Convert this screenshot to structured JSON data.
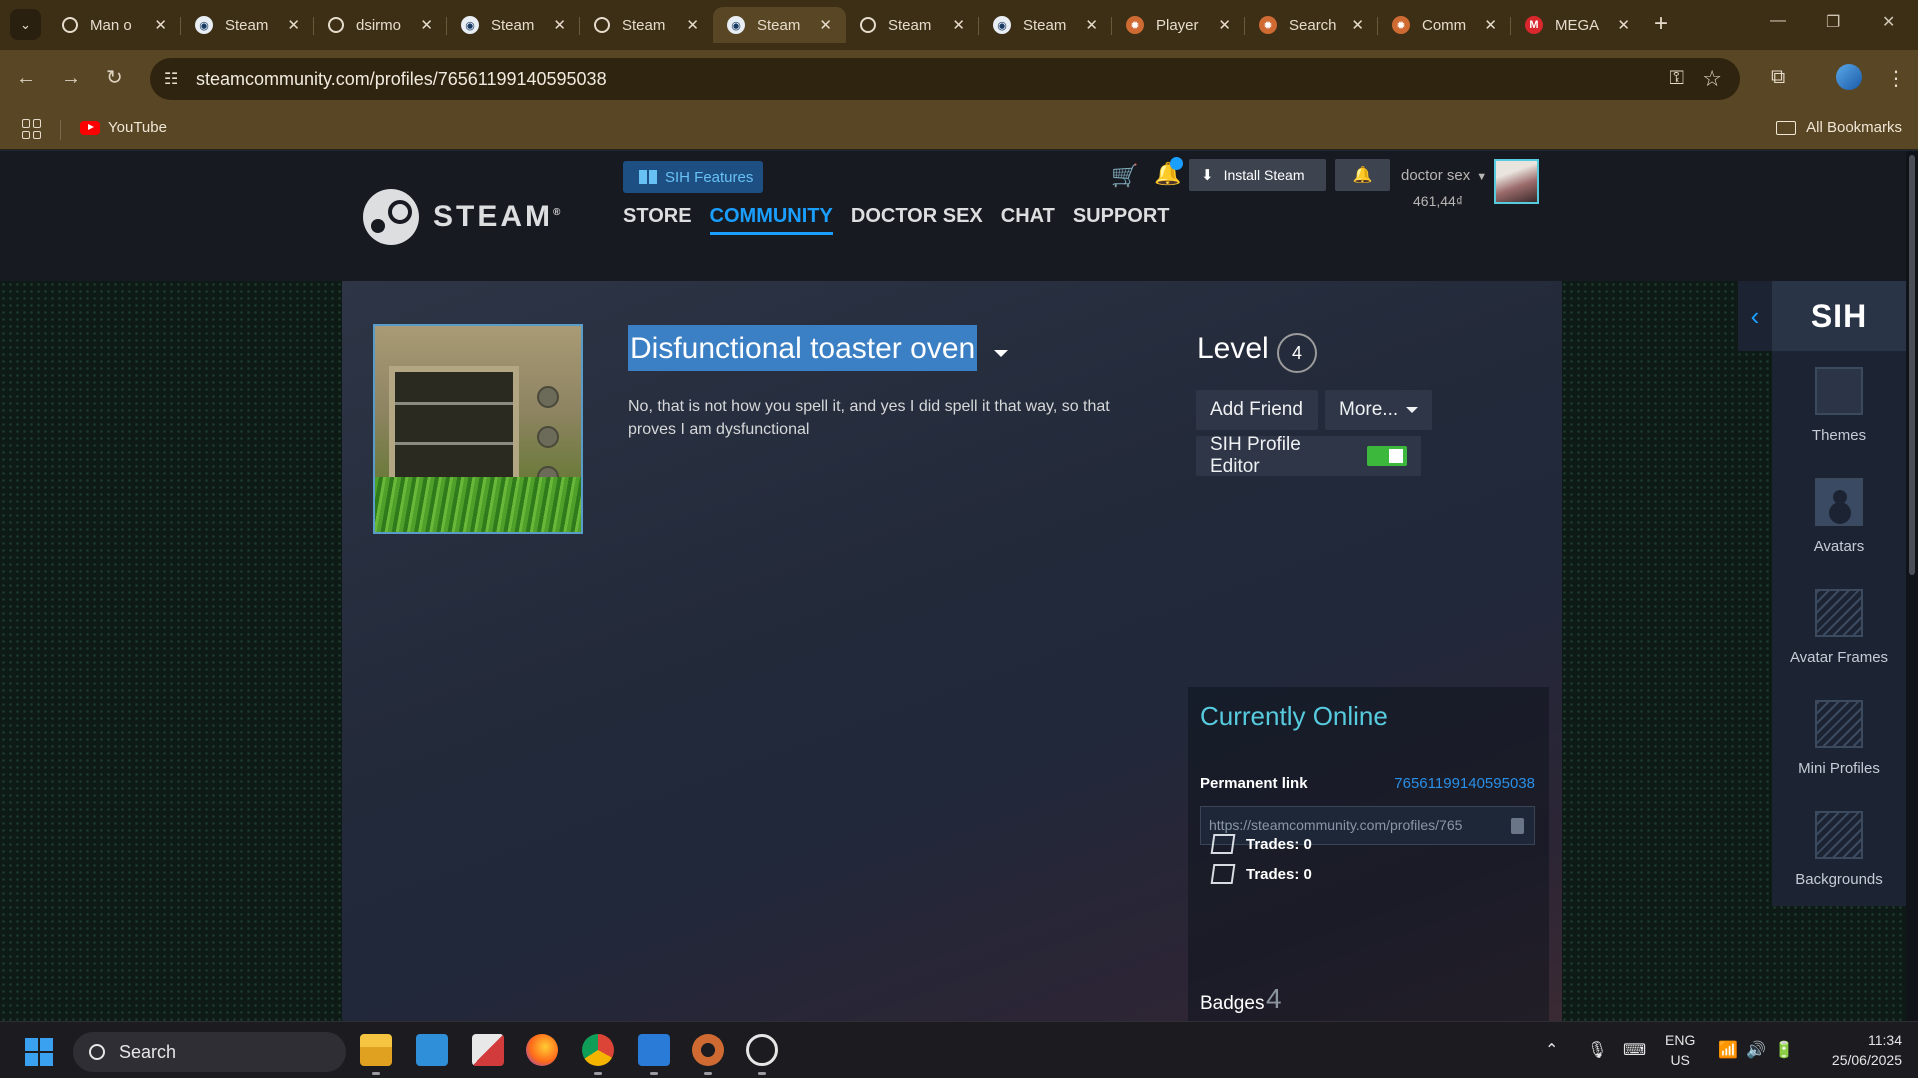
{
  "browser": {
    "tabs": [
      {
        "favicon": "search-favicon",
        "title": "Man o",
        "active": false
      },
      {
        "favicon": "steam-favicon",
        "title": "Steam",
        "active": false
      },
      {
        "favicon": "search-favicon",
        "title": "dsirmo",
        "active": false
      },
      {
        "favicon": "steam-favicon",
        "title": "Steam",
        "active": false
      },
      {
        "favicon": "search-favicon",
        "title": "Steam",
        "active": false
      },
      {
        "favicon": "steam-favicon",
        "title": "Steam",
        "active": true
      },
      {
        "favicon": "search-favicon",
        "title": "Steam",
        "active": false
      },
      {
        "favicon": "steam-favicon",
        "title": "Steam",
        "active": false
      },
      {
        "favicon": "tf2-favicon",
        "title": "Player",
        "active": false
      },
      {
        "favicon": "tf2-favicon",
        "title": "Search",
        "active": false
      },
      {
        "favicon": "tf2-favicon",
        "title": "Comm",
        "active": false
      },
      {
        "favicon": "mega-favicon",
        "title": "MEGA",
        "active": false
      }
    ],
    "mega_letter": "M",
    "url": "steamcommunity.com/profiles/76561199140595038",
    "bookmarks": {
      "youtube": "YouTube",
      "all": "All Bookmarks"
    }
  },
  "steam": {
    "logo_text": "STEAM",
    "sih_features": "SIH Features",
    "nav": [
      "STORE",
      "COMMUNITY",
      "DOCTOR SEX",
      "CHAT",
      "SUPPORT"
    ],
    "active_nav": "COMMUNITY",
    "install": "Install Steam",
    "account_name": "doctor sex",
    "wallet": "461,44₫"
  },
  "profile": {
    "persona_name": "Disfunctional toaster oven",
    "summary": "No, that is not how you spell it, and yes I did spell it that way, so that proves I am dysfunctional",
    "level_label": "Level",
    "level": "4",
    "add_friend": "Add Friend",
    "more": "More...",
    "sih_editor": "SIH Profile Editor",
    "status": "Currently Online",
    "permanent_link_label": "Permanent link",
    "permanent_link_id": "76561199140595038",
    "permanent_link_url": "https://steamcommunity.com/profiles/765",
    "trades": [
      "Trades: 0",
      "Trades: 0"
    ],
    "badges_label": "Badges",
    "badges_count": "4"
  },
  "sih_panel": {
    "logo": "SIH",
    "items": [
      "Themes",
      "Avatars",
      "Avatar Frames",
      "Mini Profiles",
      "Backgrounds"
    ]
  },
  "taskbar": {
    "search": "Search",
    "lang_top": "ENG",
    "lang_bottom": "US",
    "time": "11:34",
    "date": "25/06/2025"
  }
}
